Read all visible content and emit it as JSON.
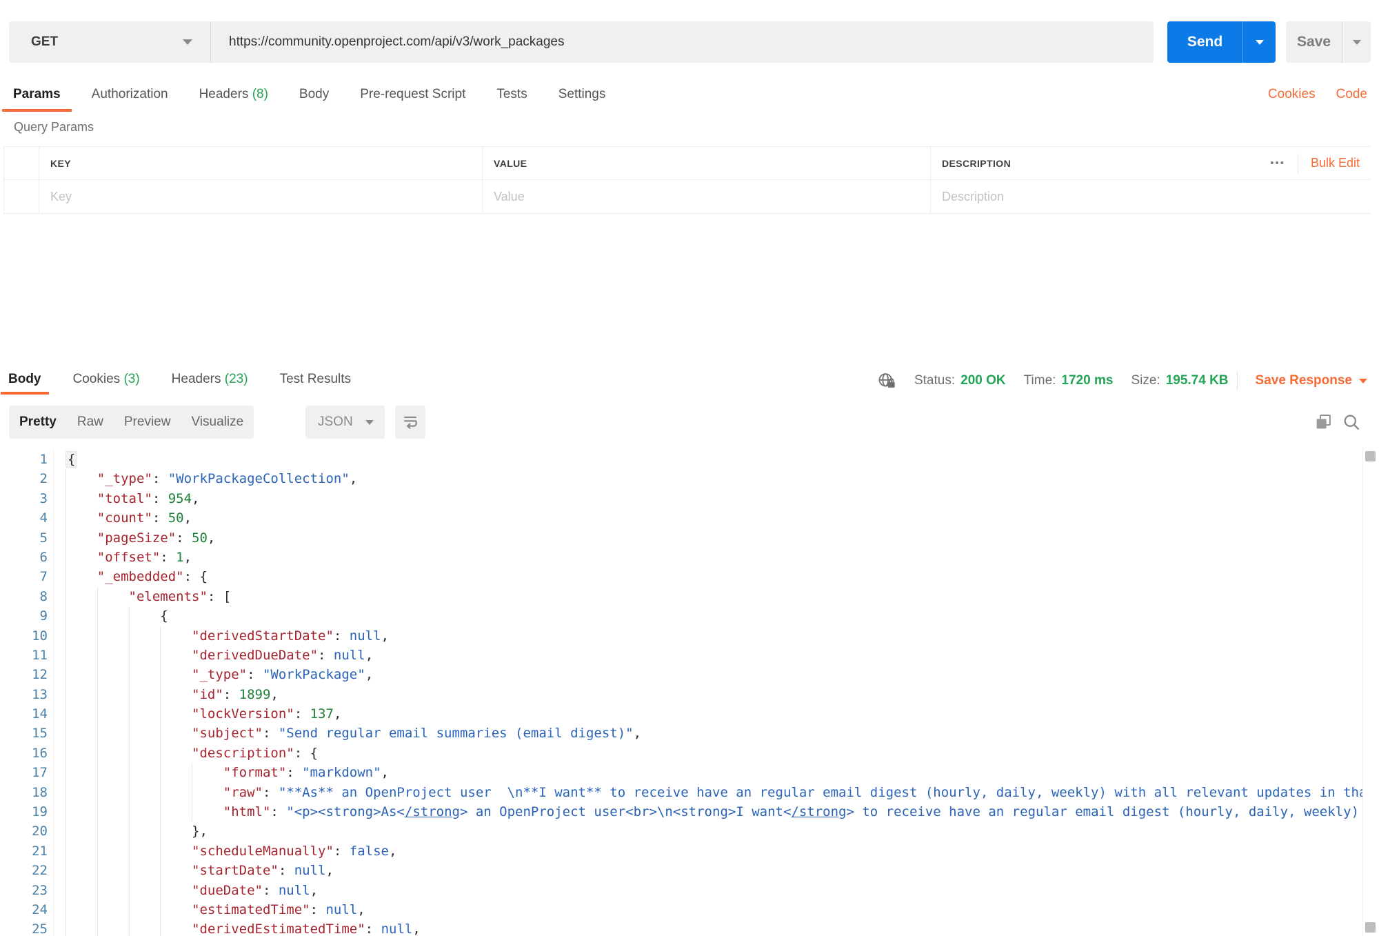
{
  "colors": {
    "orange": "#F66A35",
    "blue": "#0C7BE8",
    "green": "#23A455",
    "key": "#A5242D",
    "string": "#2A63B8",
    "number": "#1E8239",
    "atom": "#2A63B8",
    "lineno": "#4A7FA6"
  },
  "request": {
    "method": "GET",
    "url": "https://community.openproject.com/api/v3/work_packages",
    "send_label": "Send",
    "save_label": "Save",
    "tabs": [
      {
        "label": "Params",
        "active": true
      },
      {
        "label": "Authorization"
      },
      {
        "label": "Headers",
        "count": "(8)"
      },
      {
        "label": "Body"
      },
      {
        "label": "Pre-request Script"
      },
      {
        "label": "Tests"
      },
      {
        "label": "Settings"
      }
    ],
    "links": {
      "cookies": "Cookies",
      "code": "Code"
    },
    "query_params": {
      "section_title": "Query Params",
      "columns": [
        "KEY",
        "VALUE",
        "DESCRIPTION"
      ],
      "placeholders": [
        "Key",
        "Value",
        "Description"
      ],
      "more_icon": "•••",
      "bulk_edit_label": "Bulk Edit"
    }
  },
  "response": {
    "tabs": [
      {
        "label": "Body",
        "active": true
      },
      {
        "label": "Cookies",
        "count": "(3)"
      },
      {
        "label": "Headers",
        "count": "(23)"
      },
      {
        "label": "Test Results"
      }
    ],
    "meta": {
      "status_label": "Status:",
      "status_value": "200 OK",
      "time_label": "Time:",
      "time_value": "1720 ms",
      "size_label": "Size:",
      "size_value": "195.74 KB",
      "save_response_label": "Save Response"
    },
    "view_tabs": [
      {
        "label": "Pretty",
        "active": true
      },
      {
        "label": "Raw"
      },
      {
        "label": "Preview"
      },
      {
        "label": "Visualize"
      }
    ],
    "language": "JSON",
    "body_lines": [
      {
        "n": 1,
        "indent": 0,
        "tokens": [
          [
            "p",
            "{"
          ]
        ]
      },
      {
        "n": 2,
        "indent": 4,
        "tokens": [
          [
            "k",
            "\"_type\""
          ],
          [
            "p",
            ": "
          ],
          [
            "s",
            "\"WorkPackageCollection\""
          ],
          [
            "p",
            ","
          ]
        ]
      },
      {
        "n": 3,
        "indent": 4,
        "tokens": [
          [
            "k",
            "\"total\""
          ],
          [
            "p",
            ": "
          ],
          [
            "n",
            "954"
          ],
          [
            "p",
            ","
          ]
        ]
      },
      {
        "n": 4,
        "indent": 4,
        "tokens": [
          [
            "k",
            "\"count\""
          ],
          [
            "p",
            ": "
          ],
          [
            "n",
            "50"
          ],
          [
            "p",
            ","
          ]
        ]
      },
      {
        "n": 5,
        "indent": 4,
        "tokens": [
          [
            "k",
            "\"pageSize\""
          ],
          [
            "p",
            ": "
          ],
          [
            "n",
            "50"
          ],
          [
            "p",
            ","
          ]
        ]
      },
      {
        "n": 6,
        "indent": 4,
        "tokens": [
          [
            "k",
            "\"offset\""
          ],
          [
            "p",
            ": "
          ],
          [
            "n",
            "1"
          ],
          [
            "p",
            ","
          ]
        ]
      },
      {
        "n": 7,
        "indent": 4,
        "tokens": [
          [
            "k",
            "\"_embedded\""
          ],
          [
            "p",
            ": {"
          ]
        ]
      },
      {
        "n": 8,
        "indent": 8,
        "tokens": [
          [
            "k",
            "\"elements\""
          ],
          [
            "p",
            ": ["
          ]
        ]
      },
      {
        "n": 9,
        "indent": 12,
        "tokens": [
          [
            "p",
            "{"
          ]
        ]
      },
      {
        "n": 10,
        "indent": 16,
        "tokens": [
          [
            "k",
            "\"derivedStartDate\""
          ],
          [
            "p",
            ": "
          ],
          [
            "a",
            "null"
          ],
          [
            "p",
            ","
          ]
        ]
      },
      {
        "n": 11,
        "indent": 16,
        "tokens": [
          [
            "k",
            "\"derivedDueDate\""
          ],
          [
            "p",
            ": "
          ],
          [
            "a",
            "null"
          ],
          [
            "p",
            ","
          ]
        ]
      },
      {
        "n": 12,
        "indent": 16,
        "tokens": [
          [
            "k",
            "\"_type\""
          ],
          [
            "p",
            ": "
          ],
          [
            "s",
            "\"WorkPackage\""
          ],
          [
            "p",
            ","
          ]
        ]
      },
      {
        "n": 13,
        "indent": 16,
        "tokens": [
          [
            "k",
            "\"id\""
          ],
          [
            "p",
            ": "
          ],
          [
            "n",
            "1899"
          ],
          [
            "p",
            ","
          ]
        ]
      },
      {
        "n": 14,
        "indent": 16,
        "tokens": [
          [
            "k",
            "\"lockVersion\""
          ],
          [
            "p",
            ": "
          ],
          [
            "n",
            "137"
          ],
          [
            "p",
            ","
          ]
        ]
      },
      {
        "n": 15,
        "indent": 16,
        "tokens": [
          [
            "k",
            "\"subject\""
          ],
          [
            "p",
            ": "
          ],
          [
            "s",
            "\"Send regular email summaries (email digest)\""
          ],
          [
            "p",
            ","
          ]
        ]
      },
      {
        "n": 16,
        "indent": 16,
        "tokens": [
          [
            "k",
            "\"description\""
          ],
          [
            "p",
            ": {"
          ]
        ]
      },
      {
        "n": 17,
        "indent": 20,
        "tokens": [
          [
            "k",
            "\"format\""
          ],
          [
            "p",
            ": "
          ],
          [
            "s",
            "\"markdown\""
          ],
          [
            "p",
            ","
          ]
        ]
      },
      {
        "n": 18,
        "indent": 20,
        "tokens": [
          [
            "k",
            "\"raw\""
          ],
          [
            "p",
            ": "
          ],
          [
            "s",
            "\"**As** an OpenProject user  \\n**I want** to receive have an regular email digest (hourly, daily, weekly) with all relevant updates in that ti"
          ]
        ]
      },
      {
        "n": 19,
        "indent": 20,
        "tokens": [
          [
            "k",
            "\"html\""
          ],
          [
            "p",
            ": "
          ],
          [
            "s",
            "\"<p><strong>As<"
          ],
          [
            "su",
            "/strong"
          ],
          [
            "s",
            "> an OpenProject user<br>\\n<strong>I want<"
          ],
          [
            "su",
            "/strong"
          ],
          [
            "s",
            "> to receive have an regular email digest (hourly, daily, weekly) with"
          ]
        ]
      },
      {
        "n": 20,
        "indent": 16,
        "tokens": [
          [
            "p",
            "},"
          ]
        ]
      },
      {
        "n": 21,
        "indent": 16,
        "tokens": [
          [
            "k",
            "\"scheduleManually\""
          ],
          [
            "p",
            ": "
          ],
          [
            "a",
            "false"
          ],
          [
            "p",
            ","
          ]
        ]
      },
      {
        "n": 22,
        "indent": 16,
        "tokens": [
          [
            "k",
            "\"startDate\""
          ],
          [
            "p",
            ": "
          ],
          [
            "a",
            "null"
          ],
          [
            "p",
            ","
          ]
        ]
      },
      {
        "n": 23,
        "indent": 16,
        "tokens": [
          [
            "k",
            "\"dueDate\""
          ],
          [
            "p",
            ": "
          ],
          [
            "a",
            "null"
          ],
          [
            "p",
            ","
          ]
        ]
      },
      {
        "n": 24,
        "indent": 16,
        "tokens": [
          [
            "k",
            "\"estimatedTime\""
          ],
          [
            "p",
            ": "
          ],
          [
            "a",
            "null"
          ],
          [
            "p",
            ","
          ]
        ]
      },
      {
        "n": 25,
        "indent": 16,
        "tokens": [
          [
            "k",
            "\"derivedEstimatedTime\""
          ],
          [
            "p",
            ": "
          ],
          [
            "a",
            "null"
          ],
          [
            "p",
            ","
          ]
        ]
      }
    ]
  }
}
